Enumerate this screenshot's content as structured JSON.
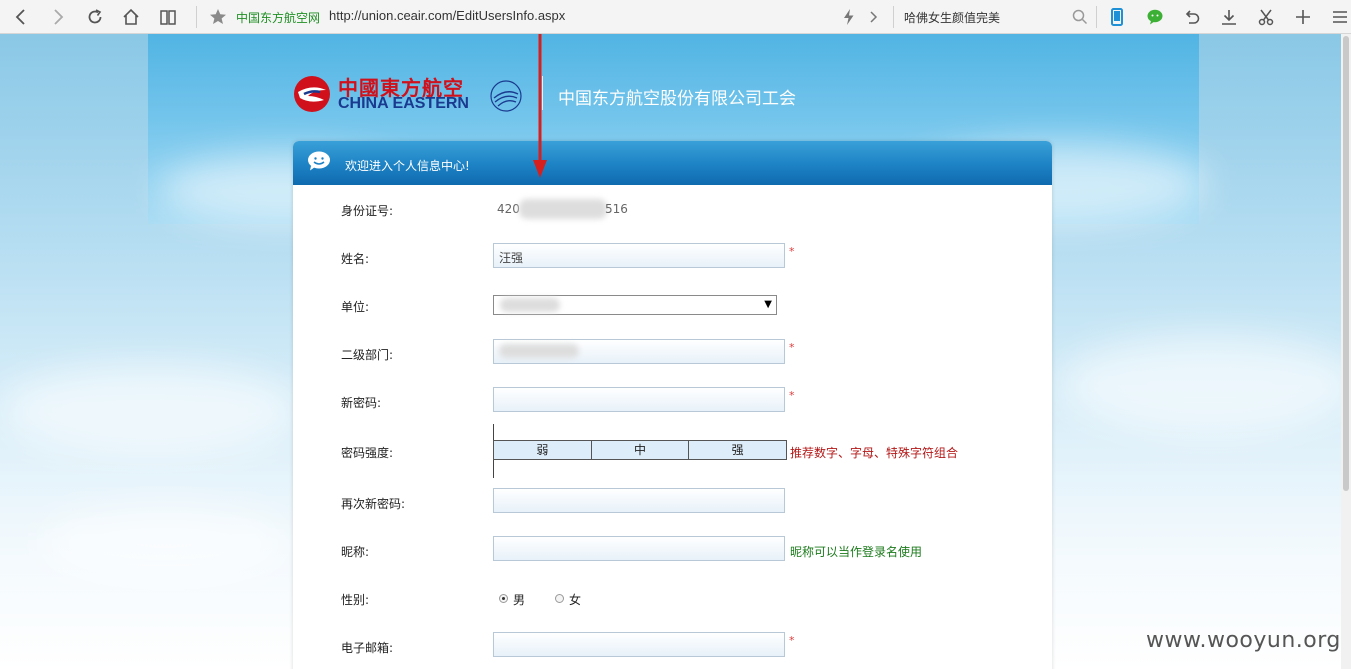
{
  "browser": {
    "site_name": "中国东方航空网",
    "url": "http://union.ceair.com/EditUsersInfo.aspx",
    "search_text": "哈佛女生颜值完美"
  },
  "header": {
    "logo_cn": "中國東方航空",
    "logo_en": "CHINA EASTERN",
    "company": "中国东方航空股份有限公司工会"
  },
  "panel": {
    "title": "欢迎进入个人信息中心!"
  },
  "form": {
    "id_label": "身份证号:",
    "id_prefix": "420",
    "id_suffix": "516",
    "name_label": "姓名:",
    "name_value": "汪强",
    "unit_label": "单位:",
    "dept_label": "二级部门:",
    "newpwd_label": "新密码:",
    "strength_label": "密码强度:",
    "strength_weak": "弱",
    "strength_mid": "中",
    "strength_strong": "强",
    "strength_hint": "推荐数字、字母、特殊字符组合",
    "repwd_label": "再次新密码:",
    "nick_label": "昵称:",
    "nick_hint": "昵称可以当作登录名使用",
    "gender_label": "性别:",
    "gender_male": "男",
    "gender_female": "女",
    "email_label": "电子邮箱:",
    "required_mark": "*"
  },
  "watermark": "www.wooyun.org",
  "colors": {
    "header_blue": "#1d82c4",
    "required_red": "#e23a3a",
    "hint_red": "#b31717",
    "hint_green": "#1b7a1b",
    "brand_red": "#d0101b"
  }
}
